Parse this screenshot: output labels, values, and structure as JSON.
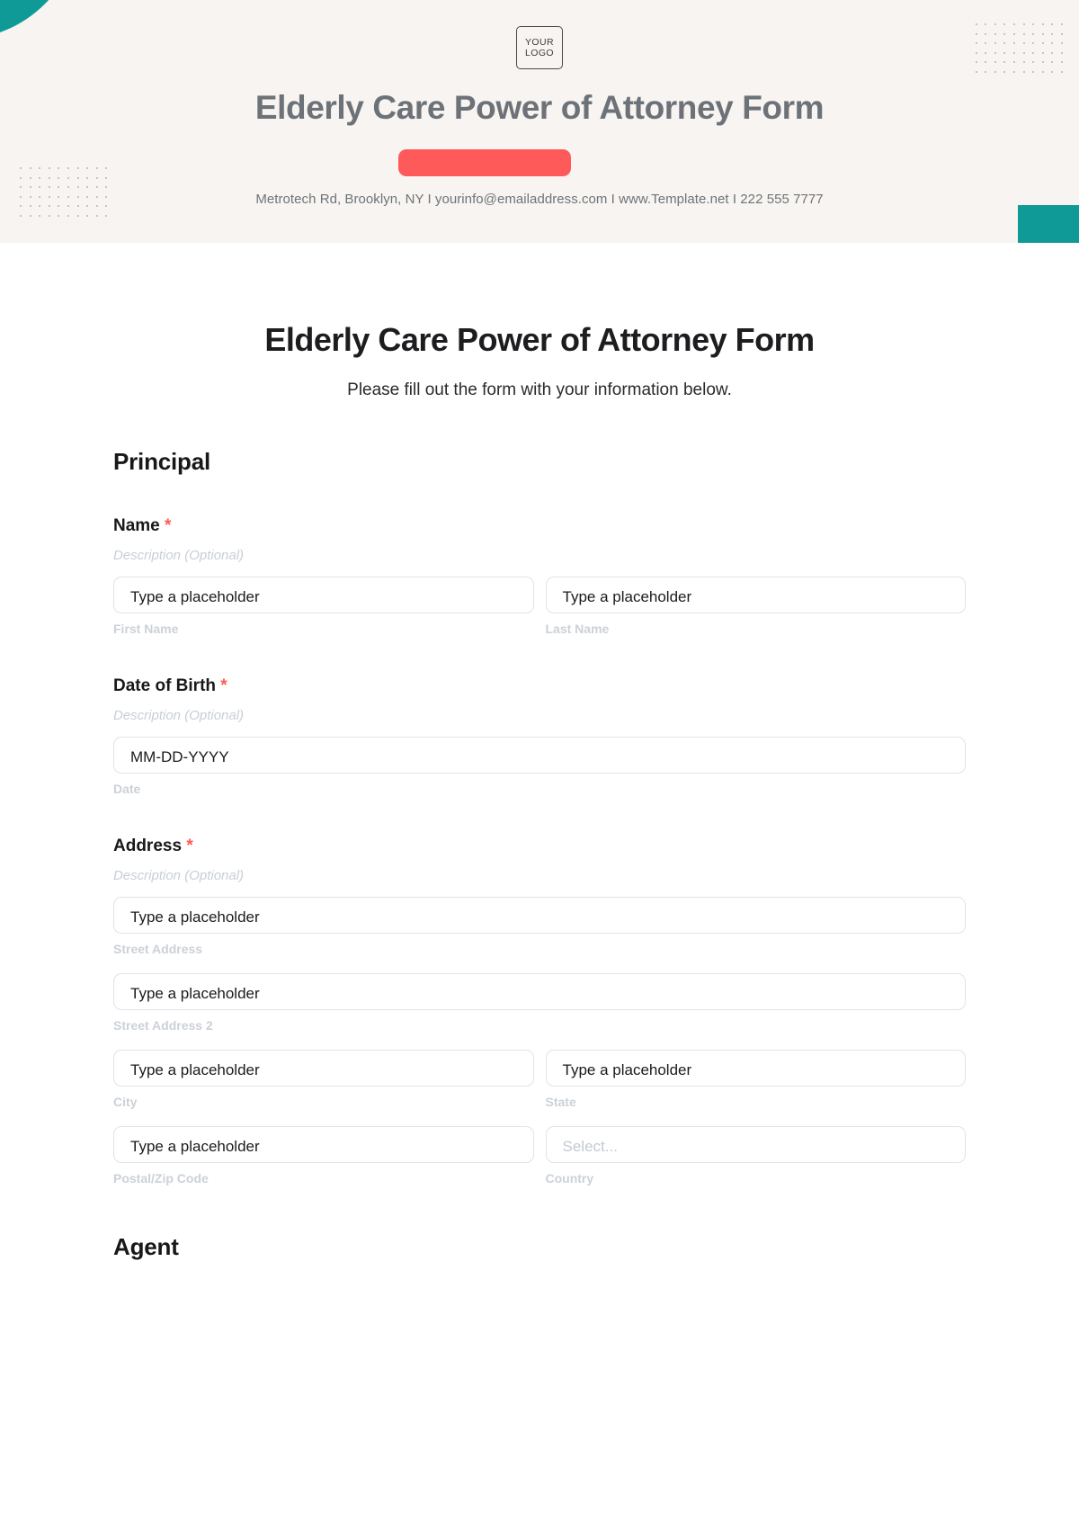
{
  "banner": {
    "logo_line1": "YOUR",
    "logo_line2": "LOGO",
    "title": "Elderly Care Power of Attorney Form",
    "contact": "Metrotech Rd, Brooklyn, NY  I  yourinfo@emailaddress.com  I  www.Template.net  I  222 555 7777",
    "accent_teal": "#109a97",
    "accent_red": "#ff5a5a",
    "background": "#f7f4f1"
  },
  "form": {
    "title": "Elderly Care Power of Attorney Form",
    "subtitle": "Please fill out the form with your information below.",
    "description_placeholder": "Description (Optional)",
    "required_mark": "*",
    "text_placeholder": "Type a placeholder",
    "select_placeholder": "Select...",
    "date_placeholder": "MM-DD-YYYY",
    "sections": [
      {
        "title": "Principal"
      },
      {
        "title": "Agent"
      }
    ],
    "fields": {
      "name": {
        "label": "Name",
        "description": "Description (Optional)",
        "first": {
          "placeholder": "Type a placeholder",
          "sublabel": "First Name"
        },
        "last": {
          "placeholder": "Type a placeholder",
          "sublabel": "Last Name"
        }
      },
      "dob": {
        "label": "Date of Birth",
        "description": "Description (Optional)",
        "date": {
          "placeholder": "MM-DD-YYYY",
          "sublabel": "Date"
        }
      },
      "address": {
        "label": "Address",
        "description": "Description (Optional)",
        "street": {
          "placeholder": "Type a placeholder",
          "sublabel": "Street Address"
        },
        "street2": {
          "placeholder": "Type a placeholder",
          "sublabel": "Street Address 2"
        },
        "city": {
          "placeholder": "Type a placeholder",
          "sublabel": "City"
        },
        "state": {
          "placeholder": "Type a placeholder",
          "sublabel": "State"
        },
        "postal": {
          "placeholder": "Type a placeholder",
          "sublabel": "Postal/Zip Code"
        },
        "country": {
          "placeholder": "Select...",
          "sublabel": "Country"
        }
      }
    }
  }
}
